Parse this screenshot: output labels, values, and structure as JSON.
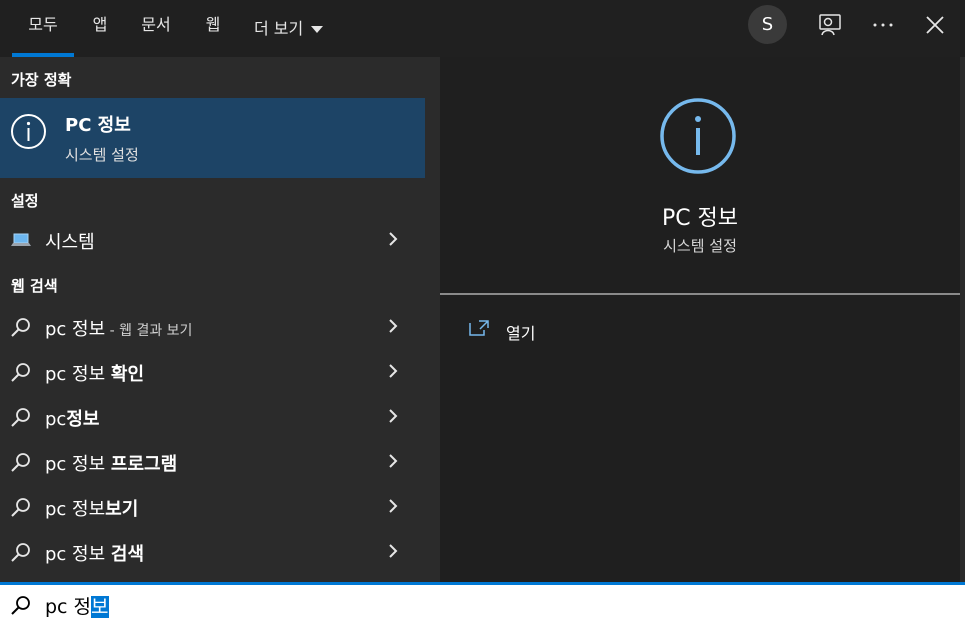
{
  "tabs": {
    "all": "모두",
    "apps": "앱",
    "documents": "문서",
    "web": "웹",
    "more": "더 보기"
  },
  "header": {
    "avatar_initial": "S",
    "icons": [
      "feedback-icon",
      "more-options-icon",
      "close-icon"
    ]
  },
  "best_match": {
    "heading": "가장 정확",
    "title": "PC 정보",
    "subtitle": "시스템 설정",
    "icon": "info-icon"
  },
  "settings": {
    "heading": "설정",
    "items": [
      {
        "label": "시스템",
        "icon": "laptop-icon"
      }
    ]
  },
  "web_search": {
    "heading": "웹 검색",
    "items": [
      {
        "prefix": "pc 정보",
        "bold": "",
        "suffix": " - 웹 결과 보기"
      },
      {
        "prefix": "pc 정보 ",
        "bold": "확인",
        "suffix": ""
      },
      {
        "prefix": "pc",
        "bold": "정보",
        "suffix": ""
      },
      {
        "prefix": "pc 정보 ",
        "bold": "프로그램",
        "suffix": ""
      },
      {
        "prefix": "pc 정보",
        "bold": "보기",
        "suffix": ""
      },
      {
        "prefix": "pc 정보 ",
        "bold": "검색",
        "suffix": ""
      }
    ]
  },
  "preview": {
    "title": "PC 정보",
    "subtitle": "시스템 설정",
    "open_label": "열기",
    "icon": "info-icon"
  },
  "search": {
    "text_unselected": "pc 정",
    "text_selected": "보"
  },
  "colors": {
    "accent": "#0078d4",
    "selected_row": "#1d4466",
    "icon_blue": "#76b9ed"
  }
}
